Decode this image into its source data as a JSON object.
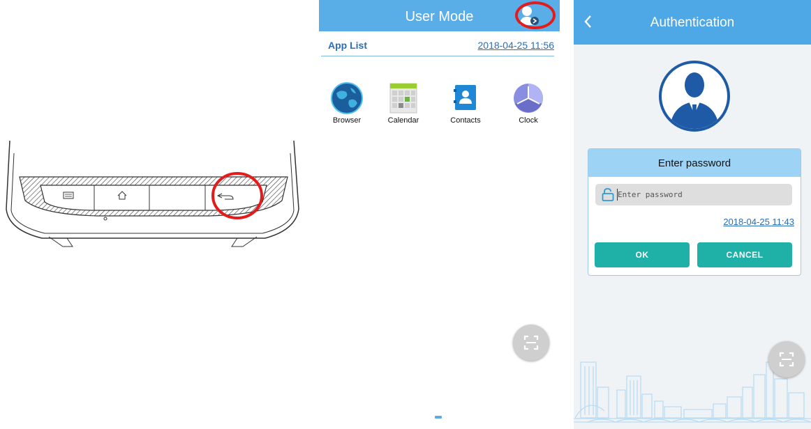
{
  "user_mode": {
    "title": "User Mode",
    "app_list_label": "App List",
    "datetime": "2018-04-25 11:56",
    "apps": [
      {
        "label": "Browser",
        "icon": "browser-globe-icon"
      },
      {
        "label": "Calendar",
        "icon": "calendar-icon"
      },
      {
        "label": "Contacts",
        "icon": "contacts-icon"
      },
      {
        "label": "Clock",
        "icon": "clock-icon"
      }
    ],
    "header_color": "#5aaee7",
    "highlight_color": "#e31b1b"
  },
  "authentication": {
    "title": "Authentication",
    "dialog_title": "Enter password",
    "password_placeholder": "Enter password",
    "datetime": "2018-04-25 11:43",
    "ok_label": "OK",
    "cancel_label": "CANCEL",
    "button_color": "#1fb0a7",
    "header_color": "#4fa8e6"
  },
  "device": {
    "buttons": [
      "menu-icon",
      "home-icon",
      "blank",
      "back-icon"
    ],
    "highlighted_button": "back-icon"
  }
}
